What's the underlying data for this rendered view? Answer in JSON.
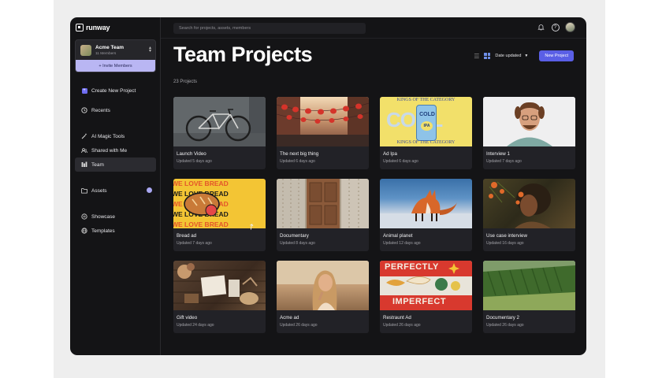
{
  "brand": {
    "logo_text": "runway"
  },
  "team": {
    "name": "Acme Team",
    "members": "11 Members",
    "invite_label": "+ Invite Members"
  },
  "sidebar": {
    "items": [
      {
        "label": "Create New Project",
        "icon": "plus-icon"
      },
      {
        "label": "Recents",
        "icon": "clock-icon"
      },
      {
        "label": "AI Magic Tools",
        "icon": "magic-wand-icon"
      },
      {
        "label": "Shared with Me",
        "icon": "shared-icon"
      },
      {
        "label": "Team",
        "icon": "team-icon",
        "active": true
      },
      {
        "label": "Assets",
        "icon": "folder-icon"
      },
      {
        "label": "Showcase",
        "icon": "showcase-icon"
      },
      {
        "label": "Templates",
        "icon": "globe-icon"
      }
    ]
  },
  "header": {
    "search_placeholder": "Search for projects, assets, members",
    "icons": [
      "bell-icon",
      "help-icon",
      "user-avatar"
    ]
  },
  "main": {
    "title": "Team Projects",
    "project_count": "23 Projects",
    "sort_label": "Date updated",
    "new_project_label": "New Project",
    "projects": [
      {
        "title": "Launch Video",
        "updated": "Updated 5 days ago"
      },
      {
        "title": "The next big thing",
        "updated": "Updated 6 days ago"
      },
      {
        "title": "Ad Ipa",
        "updated": "Updated 6 days ago"
      },
      {
        "title": "Interview 1",
        "updated": "Updated 7 days ago"
      },
      {
        "title": "Bread ad",
        "updated": "Updated 7 days ago"
      },
      {
        "title": "Documentary",
        "updated": "Updated 8 days ago"
      },
      {
        "title": "Animal planet",
        "updated": "Updated 12 days ago"
      },
      {
        "title": "Use case interview",
        "updated": "Updated 16 days ago"
      },
      {
        "title": "Gift video",
        "updated": "Updated 24 days ago"
      },
      {
        "title": "Acme ad",
        "updated": "Updated 26 days ago"
      },
      {
        "title": "Restraunt Ad",
        "updated": "Updated 26 days ago"
      },
      {
        "title": "Documentary 2",
        "updated": "Updated 26 days ago"
      }
    ]
  },
  "thumb_text": {
    "beer_top": "KINGS OF THE CATEGORY",
    "beer_can_top": "COLD",
    "beer_can_mid": "IPA",
    "beer_bottom": "KINGS OF THE CATEGORY",
    "bread_line": "WE LOVE BREAD",
    "perfect_top": "PERFECTLY",
    "perfect_bottom": "IMPERFECT"
  },
  "colors": {
    "accent": "#5a5fe6",
    "invite_bg": "#b9b6f3",
    "app_bg": "#141416"
  }
}
